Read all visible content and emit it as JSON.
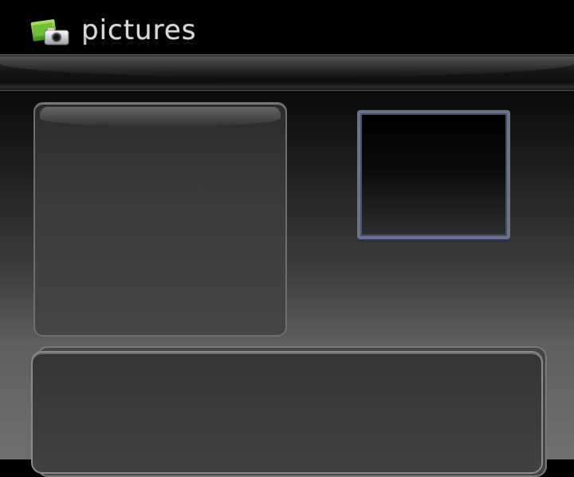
{
  "app": {
    "title": "pictures",
    "icon": "camera-photo-icon"
  },
  "colors": {
    "background_top": "#000000",
    "background_bottom": "#6f6f6f",
    "title_text": "#d8d8d8",
    "preview_border": "#6a7389",
    "panel_fill": "#3c3a39"
  }
}
